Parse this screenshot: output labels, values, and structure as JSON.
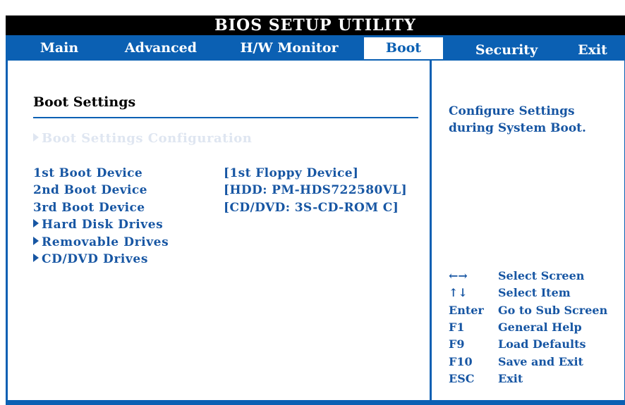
{
  "title": "BIOS SETUP UTILITY",
  "tabs": [
    {
      "label": "Main"
    },
    {
      "label": "Advanced"
    },
    {
      "label": "H/W Monitor"
    },
    {
      "label": "Boot"
    },
    {
      "label": "Security"
    },
    {
      "label": "Exit"
    }
  ],
  "active_tab": "Boot",
  "left": {
    "heading": "Boot Settings",
    "sub_config": "Boot Settings Configuration",
    "devices": [
      {
        "label": "1st Boot Device",
        "value": "[1st Floppy Device]"
      },
      {
        "label": "2nd Boot Device",
        "value": "[HDD: PM-HDS722580VL]"
      },
      {
        "label": "3rd Boot Device",
        "value": "[CD/DVD: 3S-CD-ROM C]"
      }
    ],
    "submenus": [
      {
        "label": "Hard Disk Drives"
      },
      {
        "label": "Removable Drives"
      },
      {
        "label": "CD/DVD Drives"
      }
    ]
  },
  "right": {
    "help_line1": "Configure Settings",
    "help_line2": "during System Boot.",
    "keys": [
      {
        "key": "←→",
        "desc": "Select Screen"
      },
      {
        "key": "↑↓",
        "desc": "Select Item"
      },
      {
        "key": "Enter",
        "desc": "Go to Sub Screen"
      },
      {
        "key": "F1",
        "desc": "General Help"
      },
      {
        "key": "F9",
        "desc": "Load Defaults"
      },
      {
        "key": "F10",
        "desc": "Save and Exit"
      },
      {
        "key": "ESC",
        "desc": "Exit"
      }
    ]
  },
  "colors": {
    "accent": "#0b60b3",
    "text": "#1756a3",
    "title_bg": "#000000",
    "background": "#ffffff"
  }
}
